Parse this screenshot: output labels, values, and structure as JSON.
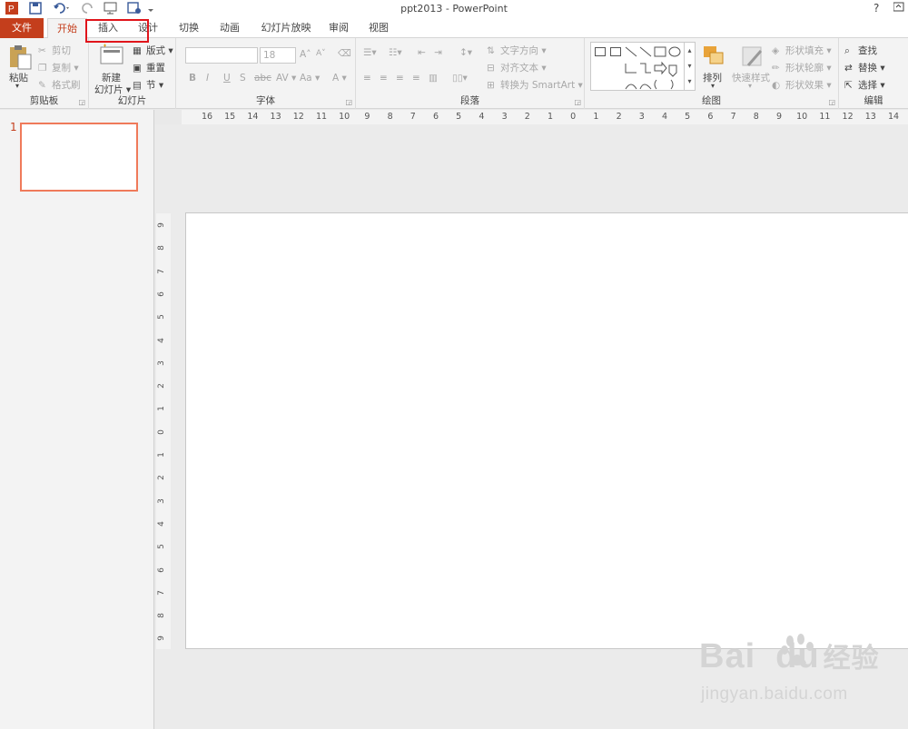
{
  "window": {
    "title": "ppt2013 - PowerPoint",
    "help": "?",
    "ribbon_display_icon": "ribbon-display-icon"
  },
  "quick_access": [
    "powerpoint-logo-icon",
    "save-icon",
    "undo-icon",
    "redo-icon",
    "start-from-beginning-icon",
    "save-as-icon",
    "customize-icon"
  ],
  "tabs": [
    "文件",
    "开始",
    "插入",
    "设计",
    "切换",
    "动画",
    "幻灯片放映",
    "审阅",
    "视图"
  ],
  "ribbon": {
    "clipboard": {
      "label": "剪贴板",
      "paste": "粘贴",
      "cut": "剪切",
      "copy": "复制",
      "format_painter": "格式刷"
    },
    "slides": {
      "label": "幻灯片",
      "new_slide_line1": "新建",
      "new_slide_line2": "幻灯片",
      "layout": "版式",
      "reset": "重置",
      "section": "节"
    },
    "font": {
      "label": "字体",
      "font_size": "18",
      "buttons": [
        "B",
        "I",
        "U",
        "S",
        "abc",
        "AV",
        "Aa",
        "A"
      ],
      "inc": "A",
      "dec": "A"
    },
    "paragraph": {
      "label": "段落",
      "text_direction": "文字方向",
      "align_text": "对齐文本",
      "convert_smartart": "转换为 SmartArt"
    },
    "drawing": {
      "label": "绘图",
      "arrange": "排列",
      "quick_styles": "快速样式",
      "shape_fill": "形状填充",
      "shape_outline": "形状轮廓",
      "shape_effects": "形状效果"
    },
    "editing": {
      "label": "编辑",
      "find": "查找",
      "replace": "替换",
      "select": "选择"
    }
  },
  "ruler": {
    "horizontal": [
      "16",
      "15",
      "14",
      "13",
      "12",
      "11",
      "10",
      "9",
      "8",
      "7",
      "6",
      "5",
      "4",
      "3",
      "2",
      "1",
      "0",
      "1",
      "2",
      "3",
      "4",
      "5",
      "6",
      "7",
      "8",
      "9",
      "10",
      "11",
      "12",
      "13",
      "14"
    ],
    "vertical": [
      "9",
      "8",
      "7",
      "6",
      "5",
      "4",
      "3",
      "2",
      "1",
      "0",
      "1",
      "2",
      "3",
      "4",
      "5",
      "6",
      "7",
      "8",
      "9"
    ]
  },
  "thumbnails": {
    "slide_number": "1"
  },
  "watermark": {
    "brand": "Bai",
    "brand2": "du",
    "cn": "经验",
    "url": "jingyan.baidu.com"
  },
  "colors": {
    "accent": "#c43e1c",
    "highlight": "#e0141b"
  }
}
